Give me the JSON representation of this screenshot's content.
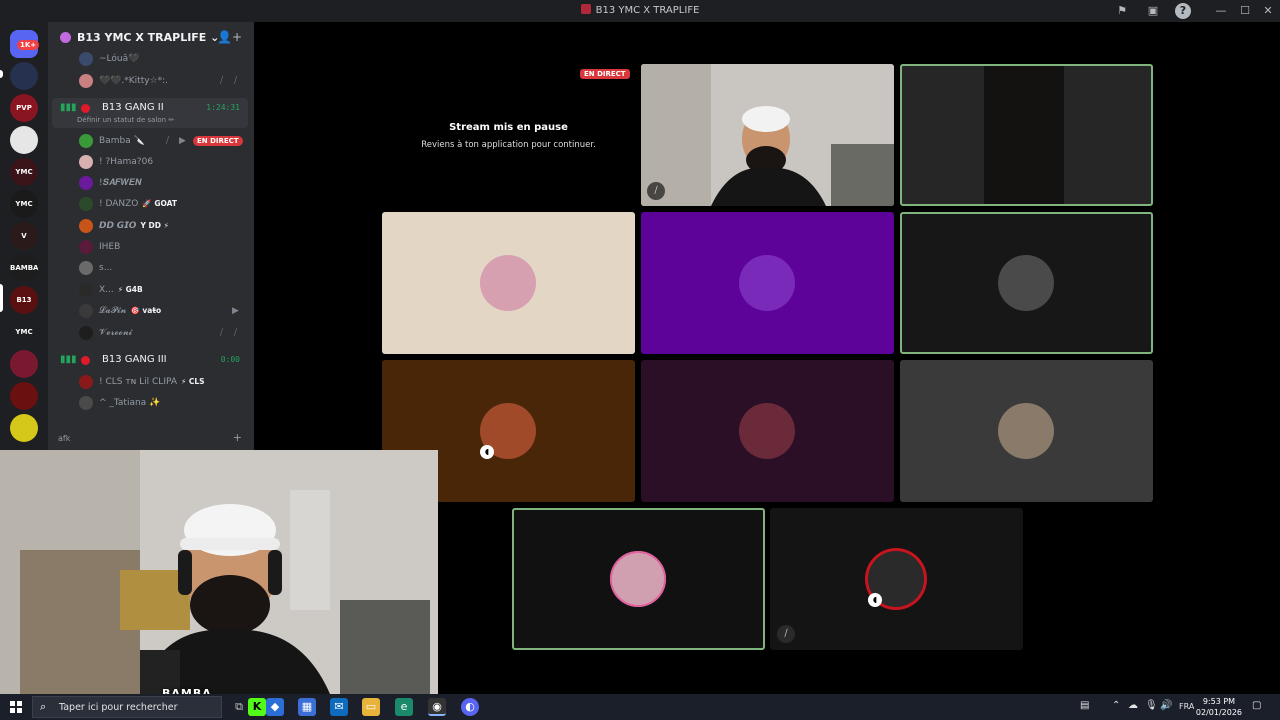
{
  "window": {
    "title": "B13 YMC X TRAPLIFE"
  },
  "servers": {
    "badge": "1K+",
    "items": [
      {
        "name": "discord-home",
        "label": "",
        "color": "#5865f2"
      },
      {
        "name": "server-1",
        "label": "",
        "color": "#26304f"
      },
      {
        "name": "server-pvp",
        "label": "PVP",
        "color": "#8a1420"
      },
      {
        "name": "server-4",
        "label": "",
        "color": "#e6e6e6"
      },
      {
        "name": "server-ymc-roleplay",
        "label": "YMC",
        "color": "#3a1418"
      },
      {
        "name": "server-ymc",
        "label": "YMC",
        "color": "#1a1a1a"
      },
      {
        "name": "server-v",
        "label": "V",
        "color": "#2b1a1a"
      },
      {
        "name": "server-bamba",
        "label": "BAMBA",
        "color": "#1d1d1d"
      },
      {
        "name": "server-b13",
        "label": "B13",
        "color": "#5a1010"
      },
      {
        "name": "server-ymc-2",
        "label": "YMC",
        "color": "#1e1f22"
      },
      {
        "name": "server-11",
        "label": "",
        "color": "#7a1830"
      },
      {
        "name": "server-outerside",
        "label": "",
        "color": "#6a1010"
      },
      {
        "name": "server-13",
        "label": "",
        "color": "#d6c81a"
      }
    ]
  },
  "guild": {
    "name": "B13 YMC X TRAPLIFE"
  },
  "channels": {
    "top_users": [
      {
        "name": "~Lóuâ🖤",
        "color": "#3a4a6a"
      },
      {
        "name": "🖤🖤.*Kitty☆*:.",
        "color": "#c88080"
      }
    ],
    "voice_1": {
      "name": "B13 GANG II",
      "timer": "1:24:31",
      "status_placeholder": "Définir un statut de salon ✏",
      "live_label": "EN DIRECT",
      "members": [
        {
          "name": "Bamba 🔪",
          "tag": "",
          "color": "#3a9a3a"
        },
        {
          "name": "! ?Hama?06",
          "tag": "",
          "color": "#d8b0b0"
        },
        {
          "name": "!𝑺𝑨𝑭𝑾𝑬𝑵",
          "tag": "",
          "color": "#6a1a9a"
        },
        {
          "name": "! DANZO",
          "tag": "🚀 GOAT",
          "color": "#2a4a2a"
        },
        {
          "name": "𝘿𝘿 𝙂𝙄𝙊",
          "tag": "Y DD ⚡",
          "color": "#c8541a"
        },
        {
          "name": "IHEB",
          "tag": "",
          "color": "#5a1a3a"
        },
        {
          "name": "s...",
          "tag": "",
          "color": "#6a6a6a"
        },
        {
          "name": "X...",
          "tag": "⚡ G4B",
          "color": "#2a2a2a"
        },
        {
          "name": "𝓛𝓪𝓟𝓲𝓷",
          "tag": "🎯 vaŧo",
          "color": "#3a3a3a"
        },
        {
          "name": "𝓥𝓮𝓻𝓸𝓸𝓷𝓲",
          "tag": "",
          "color": "#1e1e1e"
        }
      ]
    },
    "voice_2": {
      "name": "B13 GANG III",
      "timer": "0:00",
      "members": [
        {
          "name": "! CLS ᴛɴ Lil CLIPA",
          "tag": "⚡ CLS",
          "color": "#8a1a1a"
        },
        {
          "name": "^ _Tatiana ✨",
          "tag": "",
          "color": "#4a4a4a"
        }
      ]
    },
    "category": "afk"
  },
  "stage": {
    "paused_title": "Stream mis en pause",
    "paused_subtitle": "Reviens à ton application pour continuer.",
    "live_label": "EN DIRECT",
    "tiles": [
      {
        "name": "tile-webcam-bamba",
        "bg": "#c9c7c3",
        "avatar": "",
        "speaking": false
      },
      {
        "name": "tile-camera-dark",
        "bg": "#262626",
        "avatar": "",
        "speaking": true
      },
      {
        "name": "tile-hello-kitty",
        "bg": "#e3d6c5",
        "avatar": "#d6a0b0",
        "speaking": false
      },
      {
        "name": "tile-purple",
        "bg": "#5e0399",
        "avatar": "#7a2ab8",
        "speaking": false
      },
      {
        "name": "tile-bw-avatar",
        "bg": "#171717",
        "avatar": "#4a4a4a",
        "speaking": true
      },
      {
        "name": "tile-brown",
        "bg": "#4a2608",
        "avatar": "#a04a2a",
        "speaking": false
      },
      {
        "name": "tile-darkpurple",
        "bg": "#2a0f26",
        "avatar": "#6a2a3a",
        "speaking": false
      },
      {
        "name": "tile-gray",
        "bg": "#3a3a3a",
        "avatar": "#8a7a6a",
        "speaking": false
      },
      {
        "name": "tile-anime",
        "bg": "#111111",
        "avatar": "#d0a0b0",
        "speaking": true
      },
      {
        "name": "tile-redring",
        "bg": "#141414",
        "avatar": "#2a2a2a",
        "speaking": false
      }
    ]
  },
  "overlay": {
    "label": "BAMBA"
  },
  "taskbar": {
    "search_placeholder": "Taper ici pour rechercher",
    "language": "FRA",
    "time": "9:53 PM",
    "date": "02/01/2026"
  }
}
